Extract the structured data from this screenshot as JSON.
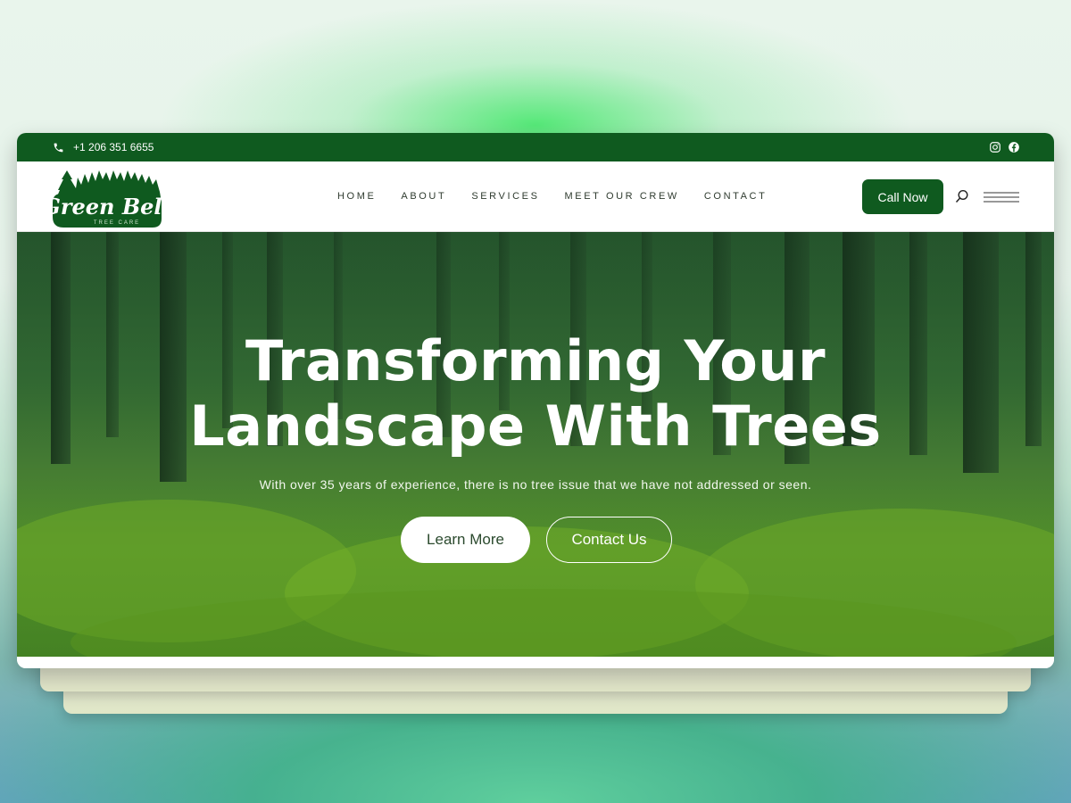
{
  "topbar": {
    "phone": "+1 206 351 6655",
    "icons": [
      "phone-icon",
      "instagram-icon",
      "facebook-icon"
    ]
  },
  "header": {
    "logo_text": "Green Belt",
    "logo_subtext": "TREE CARE",
    "nav": [
      "HOME",
      "ABOUT",
      "SERVICES",
      "MEET OUR CREW",
      "CONTACT"
    ],
    "cta": "Call Now"
  },
  "hero": {
    "title_line1": "Transforming Your",
    "title_line2": "Landscape With Trees",
    "subtitle": "With over 35 years of experience, there is no tree issue that we have not addressed or seen.",
    "primary_button": "Learn More",
    "secondary_button": "Contact Us"
  },
  "colors": {
    "brand_green": "#0f5a1f",
    "white": "#ffffff"
  }
}
